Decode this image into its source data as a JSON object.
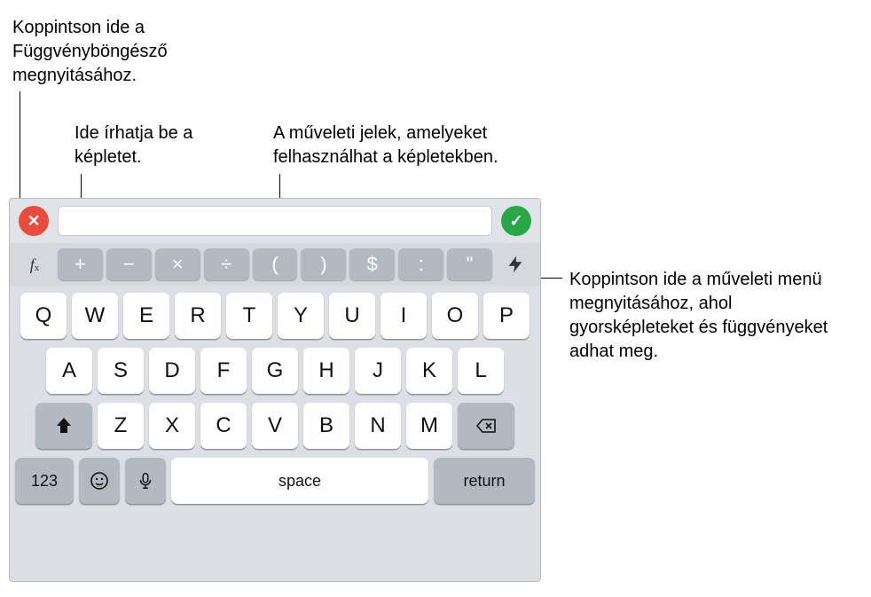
{
  "callouts": {
    "fx": "Koppintson ide a Függvényböngésző megnyitásához.",
    "input": "Ide írhatja be a képletet.",
    "ops": "A műveleti jelek, amelyeket felhasználhat a képletekben.",
    "bolt": "Koppintson ide a műveleti menü megnyitásához, ahol gyorsképleteket és függvényeket adhat meg."
  },
  "formula": {
    "input_value": "",
    "placeholder": "",
    "cancel_icon": "✕",
    "accept_icon": "✓",
    "fx_label": "f",
    "fx_sub": "x",
    "bolt_icon": "⚡"
  },
  "operators": [
    "+",
    "−",
    "×",
    "÷",
    "(",
    ")",
    "$",
    ":",
    "\""
  ],
  "qwerty": {
    "row1": [
      "Q",
      "W",
      "E",
      "R",
      "T",
      "Y",
      "U",
      "I",
      "O",
      "P"
    ],
    "row2": [
      "A",
      "S",
      "D",
      "F",
      "G",
      "H",
      "J",
      "K",
      "L"
    ],
    "row3": [
      "Z",
      "X",
      "C",
      "V",
      "B",
      "N",
      "M"
    ]
  },
  "bottom": {
    "num": "123",
    "emoji": "☺",
    "mic": "🎤",
    "space": "space",
    "return": "return"
  }
}
